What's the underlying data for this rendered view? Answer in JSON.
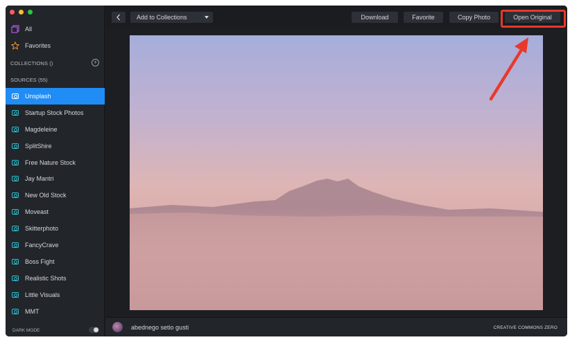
{
  "sidebar": {
    "all_label": "All",
    "favorites_label": "Favorites",
    "collections_header": "COLLECTIONS ()",
    "sources_header": "SOURCES (55)",
    "sources": [
      {
        "label": "Unsplash",
        "icon": "camera-icon",
        "active": true
      },
      {
        "label": "Startup Stock Photos",
        "icon": "camera-icon"
      },
      {
        "label": "Magdeleine",
        "icon": "camera-icon"
      },
      {
        "label": "SplitShire",
        "icon": "camera-icon"
      },
      {
        "label": "Free Nature Stock",
        "icon": "camera-icon"
      },
      {
        "label": "Jay Mantri",
        "icon": "camera-icon"
      },
      {
        "label": "New Old Stock",
        "icon": "camera-icon"
      },
      {
        "label": "Moveast",
        "icon": "camera-icon"
      },
      {
        "label": "Skitterphoto",
        "icon": "camera-icon"
      },
      {
        "label": "FancyCrave",
        "icon": "camera-icon"
      },
      {
        "label": "Boss Fight",
        "icon": "camera-icon"
      },
      {
        "label": "Realistic Shots",
        "icon": "camera-icon"
      },
      {
        "label": "Little Visuals",
        "icon": "camera-icon"
      },
      {
        "label": "MMT",
        "icon": "camera-icon"
      }
    ],
    "dark_mode_label": "DARK MODE"
  },
  "toolbar": {
    "back_icon": "chevron-left-icon",
    "collections_select_value": "Add to Collections",
    "download_label": "Download",
    "favorite_label": "Favorite",
    "copy_photo_label": "Copy Photo",
    "open_original_label": "Open Original"
  },
  "footer": {
    "author_name": "abednego setio gusti",
    "license_label": "CREATIVE COMMONS ZERO"
  },
  "colors": {
    "accent": "#1f8df5",
    "annotation_red": "#e8392b",
    "camera_icon": "#2ec4d6",
    "sidebar_bg": "#22252a",
    "window_bg": "#1c1e22"
  }
}
